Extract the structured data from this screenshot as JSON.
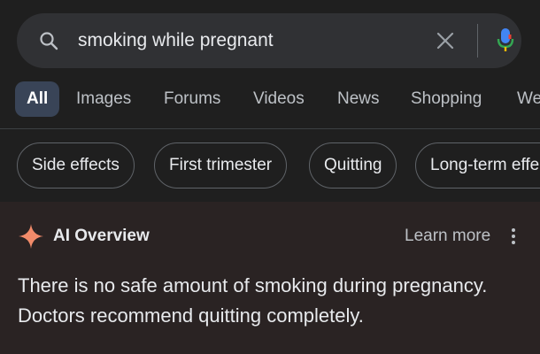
{
  "search": {
    "query": "smoking while pregnant",
    "icons": [
      "search-icon",
      "clear-icon",
      "microphone-icon"
    ]
  },
  "tabs": [
    {
      "label": "All",
      "active": true
    },
    {
      "label": "Images"
    },
    {
      "label": "Forums"
    },
    {
      "label": "Videos"
    },
    {
      "label": "News"
    },
    {
      "label": "Shopping"
    },
    {
      "label": "Web"
    }
  ],
  "chips": [
    {
      "label": "Side effects"
    },
    {
      "label": "First trimester"
    },
    {
      "label": "Quitting"
    },
    {
      "label": "Long-term effects"
    }
  ],
  "ai_overview": {
    "title": "AI Overview",
    "learn_more": "Learn more",
    "answer": "There is no safe amount of smoking during pregnancy. Doctors recommend quitting completely."
  },
  "colors": {
    "background": "#1f1f1f",
    "search_bar": "#303134",
    "active_tab": "#394457",
    "ai_section": "#2a2323",
    "spark": "#f28b6a",
    "mic_blue": "#4285f4",
    "mic_red": "#ea4335"
  }
}
